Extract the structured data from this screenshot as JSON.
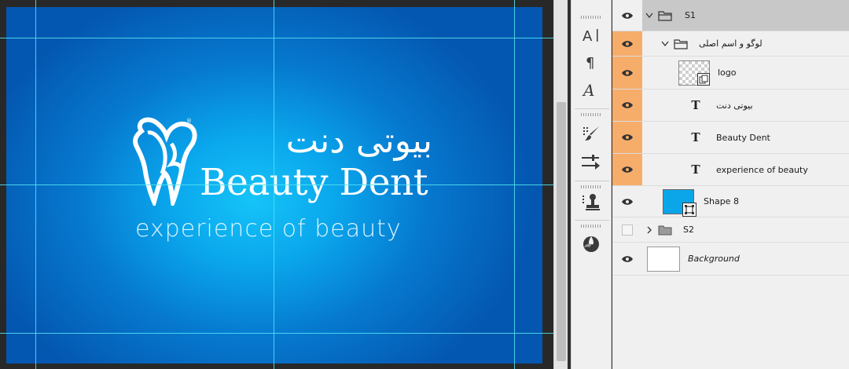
{
  "artwork": {
    "brand_fa": "بیوتی دنت",
    "brand_en": "Beauty Dent",
    "tagline": "experience of beauty",
    "registered_mark": "®",
    "colors": {
      "bg_center": "#15c4f8",
      "bg_edge": "#0457b0",
      "guide": "#4fe0f0"
    }
  },
  "tools": [
    {
      "name": "character-panel-icon"
    },
    {
      "name": "paragraph-panel-icon"
    },
    {
      "name": "glyphs-panel-icon"
    },
    {
      "name": "brush-settings-icon"
    },
    {
      "name": "adjustments-icon"
    },
    {
      "name": "clone-source-icon"
    },
    {
      "name": "materials-icon"
    }
  ],
  "layers": {
    "s1": {
      "label": "S1"
    },
    "logo_group": {
      "label": "لوگو و اسم اصلی"
    },
    "logo": {
      "label": "logo"
    },
    "text_fa": {
      "label": "بیوتی دنت"
    },
    "text_en": {
      "label": "Beauty Dent"
    },
    "text_tagline": {
      "label": "experience of beauty"
    },
    "shape8": {
      "label": "Shape 8"
    },
    "s2": {
      "label": "S2"
    },
    "background": {
      "label": "Background"
    },
    "colors": {
      "linked_highlight": "#f7ad6a",
      "selected_row": "#c8c8c8",
      "shape_thumb": "#0ba6ea"
    }
  }
}
